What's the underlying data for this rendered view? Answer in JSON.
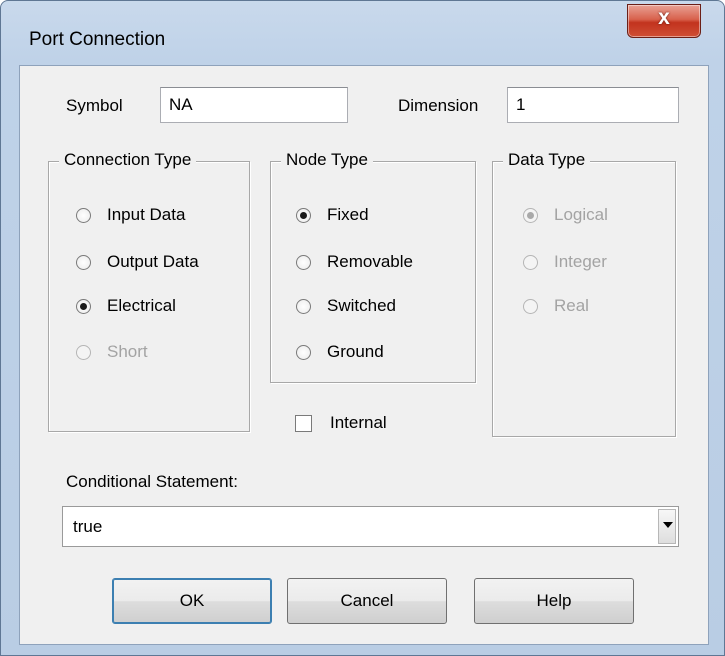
{
  "window": {
    "title": "Port Connection",
    "close_label": "x"
  },
  "symbol": {
    "label": "Symbol",
    "value": "NA"
  },
  "dimension": {
    "label": "Dimension",
    "value": "1"
  },
  "connection_type": {
    "title": "Connection Type",
    "options": [
      {
        "label": "Input Data",
        "checked": false,
        "disabled": false
      },
      {
        "label": "Output Data",
        "checked": false,
        "disabled": false
      },
      {
        "label": "Electrical",
        "checked": true,
        "disabled": false
      },
      {
        "label": "Short",
        "checked": false,
        "disabled": true
      }
    ]
  },
  "node_type": {
    "title": "Node Type",
    "options": [
      {
        "label": "Fixed",
        "checked": true,
        "disabled": false
      },
      {
        "label": "Removable",
        "checked": false,
        "disabled": false
      },
      {
        "label": "Switched",
        "checked": false,
        "disabled": false
      },
      {
        "label": "Ground",
        "checked": false,
        "disabled": false
      }
    ]
  },
  "data_type": {
    "title": "Data Type",
    "options": [
      {
        "label": "Logical",
        "checked": true,
        "disabled": true
      },
      {
        "label": "Integer",
        "checked": false,
        "disabled": true
      },
      {
        "label": "Real",
        "checked": false,
        "disabled": true
      }
    ]
  },
  "internal": {
    "label": "Internal",
    "checked": false
  },
  "conditional": {
    "label": "Conditional Statement:",
    "value": "true"
  },
  "buttons": {
    "ok": "OK",
    "cancel": "Cancel",
    "help": "Help"
  },
  "icons": {
    "close": "close-icon",
    "dropdown": "chevron-down-icon"
  }
}
